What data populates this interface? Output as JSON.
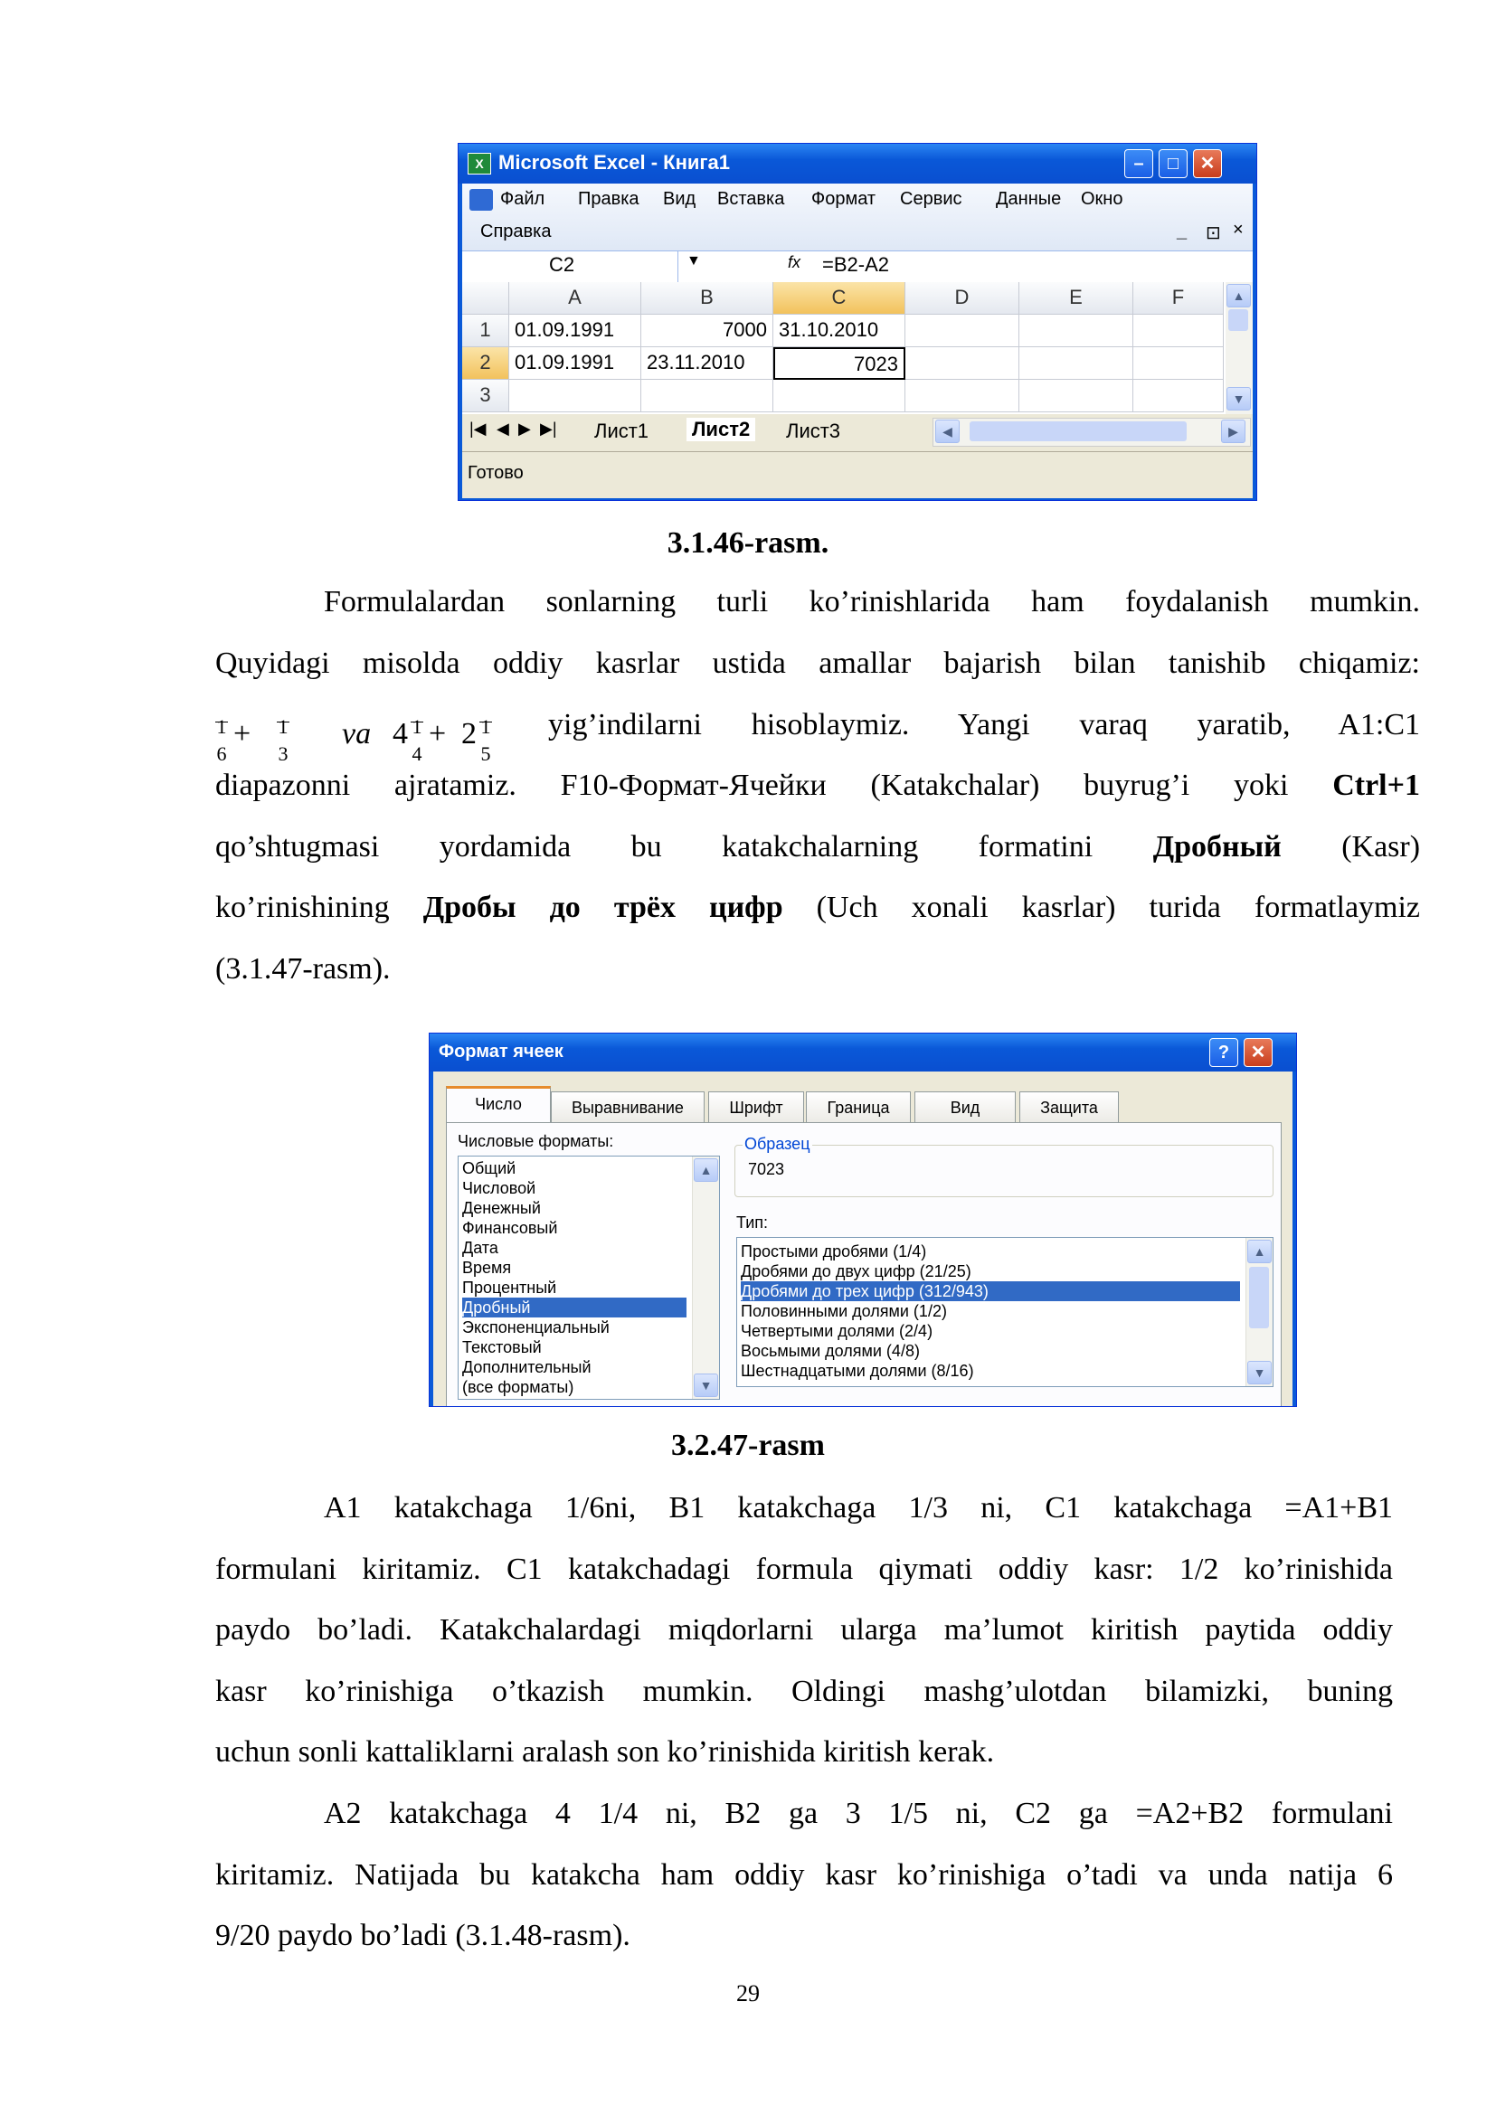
{
  "excel": {
    "title": "Microsoft Excel - Книга1",
    "icon": "excel-icon",
    "menu": [
      "Файл",
      "Правка",
      "Вид",
      "Вставка",
      "Формат",
      "Сервис",
      "Данные",
      "Окно"
    ],
    "menu2": "Справка",
    "window_ctrl": [
      "_",
      "⊡",
      "×"
    ],
    "name_box": "C2",
    "fx": "fx",
    "formula": "=B2-A2",
    "columns": [
      "A",
      "B",
      "C",
      "D",
      "E",
      "F"
    ],
    "rows": [
      {
        "num": "1",
        "a": "01.09.1991",
        "b": "7000",
        "c": "31.10.2010"
      },
      {
        "num": "2",
        "a": "01.09.1991",
        "b": "23.11.2010",
        "c": "7023"
      },
      {
        "num": "3",
        "a": "",
        "b": "",
        "c": ""
      }
    ],
    "sheets": [
      "Лист1",
      "Лист2",
      "Лист3"
    ],
    "active_sheet": "Лист2",
    "status": "Готово",
    "selected_cell": "C2"
  },
  "caption1": "3.1.46-rasm.",
  "para1": {
    "line1": "Formulalardan sonlarning turli ko’rinishlarida ham foydalanish mumkin.",
    "line2": "Quyidagi misolda oddiy kasrlar ustida amallar bajarish bilan tanishib chiqamiz:",
    "math_va": "va",
    "line3_text": "yig’indilarni hisoblaymiz. Yangi varaq yaratib, A1:C1",
    "line4_a": "diapazonni ajratamiz. F10-Формат-Ячейки (Katakchalar) buyrug’i yoki",
    "line4_b": "Ctrl+1",
    "line5_a": "qo’shtugmasi yordamida bu katakchalarning formatini",
    "line5_b": "Дробный",
    "line5_c": "(Kasr)",
    "line6_a": "ko’rinishining",
    "line6_b": "Дробы до трёх цифр",
    "line6_c": "(Uch xonali kasrlar) turida formatlaymiz",
    "line7": "(3.1.47-rasm)."
  },
  "math": {
    "f1": {
      "num": "1",
      "den": "6"
    },
    "f2": {
      "num": "1",
      "den": "3"
    },
    "m1": {
      "whole": "4",
      "num": "1",
      "den": "4"
    },
    "m2": {
      "whole": "2",
      "num": "1",
      "den": "5"
    },
    "plus": "+"
  },
  "dialog": {
    "title": "Формат ячеек",
    "help": "?",
    "close": "×",
    "tabs": [
      "Число",
      "Выравнивание",
      "Шрифт",
      "Граница",
      "Вид",
      "Защита"
    ],
    "formats_label": "Числовые форматы:",
    "formats": [
      "Общий",
      "Числовой",
      "Денежный",
      "Финансовый",
      "Дата",
      "Время",
      "Процентный",
      "Дробный",
      "Экспоненциальный",
      "Текстовый",
      "Дополнительный",
      "(все форматы)"
    ],
    "selected_format": "Дробный",
    "sample_label": "Образец",
    "sample_value": "7023",
    "type_label": "Тип:",
    "types": [
      "Простыми дробями (1/4)",
      "Дробями до двух цифр (21/25)",
      "Дробями до трех цифр (312/943)",
      "Половинными долями (1/2)",
      "Четвертыми долями (2/4)",
      "Восьмыми долями (4/8)",
      "Шестнадцатыми долями (8/16)"
    ],
    "selected_type": "Дробями до трех цифр (312/943)"
  },
  "caption2": "3.2.47-rasm",
  "para2": {
    "line1": "A1 katakchaga 1/6ni, B1 katakchaga 1/3 ni, C1 katakchaga =A1+B1",
    "line2": "formulani kiritamiz. C1 katakchadagi formula qiymati oddiy kasr: 1/2 ko’rinishida",
    "line3": "paydo bo’ladi. Katakchalardagi miqdorlarni ularga ma’lumot kiritish paytida oddiy",
    "line4": "kasr ko’rinishiga o’tkazish mumkin. Oldingi mashg’ulotdan bilamizki, buning",
    "line5": "uchun sonli kattaliklarni aralash son ko’rinishida kiritish kerak."
  },
  "para3": {
    "line1": "A2 katakchaga 4 1/4 ni, B2 ga 3 1/5 ni, C2 ga =A2+B2 formulani",
    "line2": "kiritamiz. Natijada bu katakcha ham oddiy kasr ko’rinishiga o’tadi va unda natija 6",
    "line3": "9/20 paydo bo’ladi (3.1.48-rasm)."
  },
  "page_number": "29"
}
